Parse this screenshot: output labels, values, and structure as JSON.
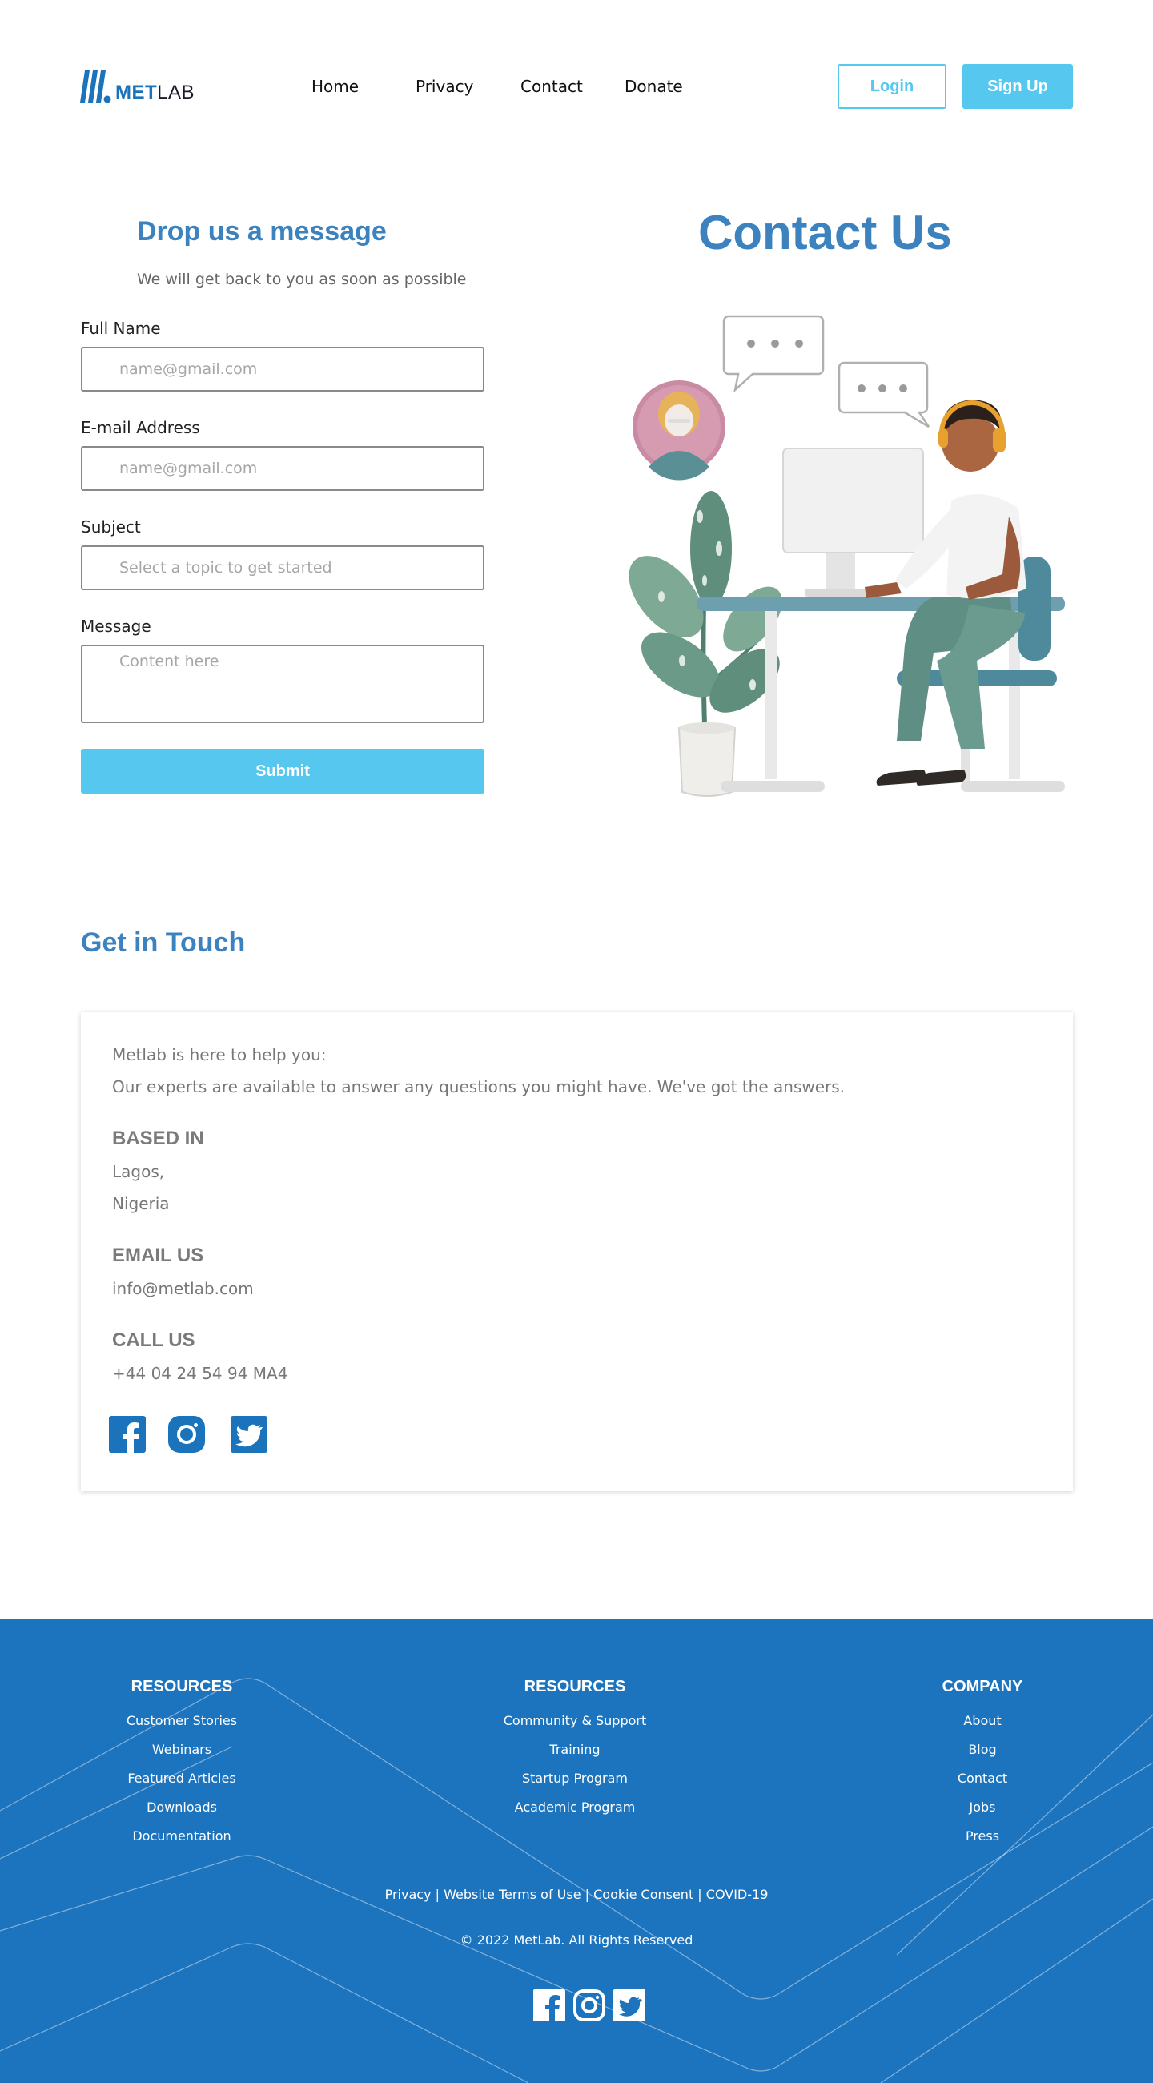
{
  "header": {
    "logo": {
      "prefix": "MET",
      "suffix": "LAB"
    },
    "nav": [
      "Home",
      "Privacy",
      "Contact",
      "Donate"
    ],
    "login_label": "Login",
    "signup_label": "Sign Up"
  },
  "form": {
    "title": "Drop us a message",
    "subtitle": "We will get back to you as soon as possible",
    "full_name": {
      "label": "Full Name",
      "placeholder": "name@gmail.com",
      "value": ""
    },
    "email": {
      "label": "E-mail Address",
      "placeholder": "name@gmail.com",
      "value": ""
    },
    "subject": {
      "label": "Subject",
      "placeholder": "Select a topic to get started",
      "value": ""
    },
    "message": {
      "label": "Message",
      "placeholder": "Content here",
      "value": ""
    },
    "submit_label": "Submit"
  },
  "contact_title": "Contact Us",
  "get_in_touch": {
    "title": "Get in Touch",
    "intro1": "Metlab is here to help you:",
    "intro2": "Our experts are available to answer any questions you might have. We've got the answers.",
    "based_head": "BASED IN",
    "based_line1": "Lagos,",
    "based_line2": "Nigeria",
    "email_head": "EMAIL US",
    "email_value": "info@metlab.com",
    "call_head": "CALL US",
    "call_value": "+44 04 24 54 94 MA4",
    "socials": [
      "facebook-icon",
      "instagram-icon",
      "twitter-icon"
    ]
  },
  "footer": {
    "columns": [
      {
        "head": "RESOURCES",
        "items": [
          "Customer Stories",
          "Webinars",
          "Featured Articles",
          "Downloads",
          "Documentation"
        ]
      },
      {
        "head": "RESOURCES",
        "items": [
          "Community & Support",
          "Training",
          "Startup Program",
          "Academic Program"
        ]
      },
      {
        "head": "COMPANY",
        "items": [
          "About",
          "Blog",
          "Contact",
          "Jobs",
          "Press"
        ]
      }
    ],
    "legal": "Privacy | Website Terms of Use | Cookie Consent | COVID-19",
    "copyright": "© 2022 MetLab. All Rights Reserved",
    "background": "#1c74be"
  },
  "colors": {
    "accent": "#56c8f0",
    "heading": "#3b82be",
    "brand": "#1b73bb"
  }
}
